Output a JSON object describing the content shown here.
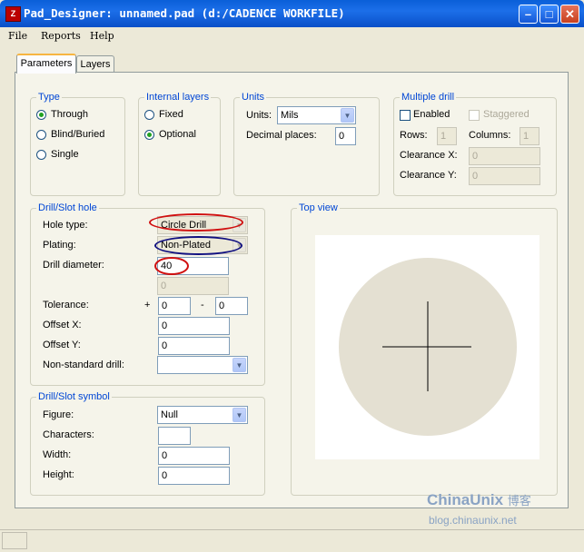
{
  "window": {
    "title": "Pad_Designer: unnamed.pad (d:/CADENCE WORKFILE)",
    "icon_letter": "Z"
  },
  "menu": {
    "file": "File",
    "reports": "Reports",
    "help": "Help"
  },
  "tabs": [
    {
      "label": "Parameters",
      "active": true
    },
    {
      "label": "Layers",
      "active": false
    }
  ],
  "type_group": {
    "title": "Type",
    "options": [
      {
        "label": "Through",
        "selected": true
      },
      {
        "label": "Blind/Buried",
        "selected": false
      },
      {
        "label": "Single",
        "selected": false
      }
    ]
  },
  "internal_layers": {
    "title": "Internal layers",
    "options": [
      {
        "label": "Fixed",
        "selected": false
      },
      {
        "label": "Optional",
        "selected": true
      }
    ]
  },
  "units_group": {
    "title": "Units",
    "units_label": "Units:",
    "units_value": "Mils",
    "decimal_label": "Decimal places:",
    "decimal_value": "0"
  },
  "multiple_drill": {
    "title": "Multiple drill",
    "enabled_label": "Enabled",
    "enabled_checked": false,
    "staggered_label": "Staggered",
    "staggered_checked": false,
    "rows_label": "Rows:",
    "rows_value": "1",
    "columns_label": "Columns:",
    "columns_value": "1",
    "clearance_x_label": "Clearance X:",
    "clearance_x_value": "0",
    "clearance_y_label": "Clearance Y:",
    "clearance_y_value": "0"
  },
  "drill_slot_hole": {
    "title": "Drill/Slot hole",
    "hole_type_label": "Hole type:",
    "hole_type_value": "Circle Drill",
    "plating_label": "Plating:",
    "plating_value": "Non-Plated",
    "drill_diameter_label": "Drill diameter:",
    "drill_diameter_value": "40",
    "second_value": "0",
    "tolerance_label": "Tolerance:",
    "tolerance_plus_sign": "+",
    "tolerance_plus_value": "0",
    "tolerance_minus_sign": "-",
    "tolerance_minus_value": "0",
    "offset_x_label": "Offset X:",
    "offset_x_value": "0",
    "offset_y_label": "Offset Y:",
    "offset_y_value": "0",
    "non_standard_label": "Non-standard drill:",
    "non_standard_value": ""
  },
  "drill_slot_symbol": {
    "title": "Drill/Slot symbol",
    "figure_label": "Figure:",
    "figure_value": "Null",
    "characters_label": "Characters:",
    "characters_value": "",
    "width_label": "Width:",
    "width_value": "0",
    "height_label": "Height:",
    "height_value": "0"
  },
  "top_view": {
    "title": "Top view",
    "pad_fill": "#e4e0d2"
  },
  "watermark": {
    "brand": "ChinaUnix",
    "brand_cn": "博客",
    "url": "blog.chinaunix.net"
  },
  "colors": {
    "annotation_red": "#d01010",
    "annotation_blue": "#101080",
    "legend_blue": "#0046d5"
  }
}
